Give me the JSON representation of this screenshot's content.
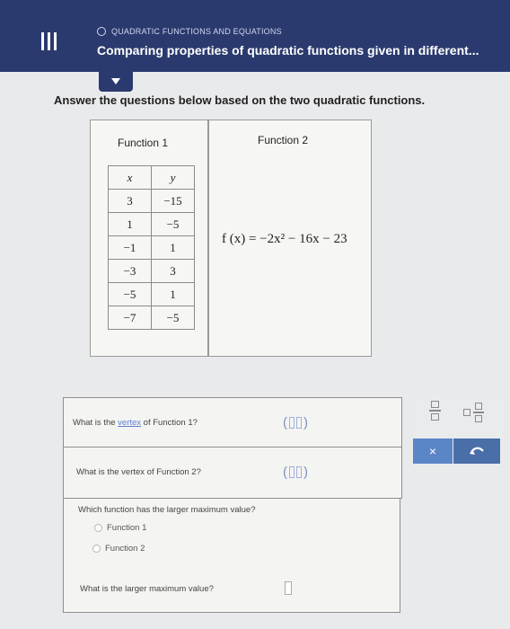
{
  "header": {
    "topic": "QUADRATIC FUNCTIONS AND EQUATIONS",
    "lesson_title": "Comparing properties of quadratic functions given in different..."
  },
  "instructions": "Answer the questions below based on the two quadratic functions.",
  "function1": {
    "title": "Function 1",
    "columns": [
      "x",
      "y"
    ],
    "rows": [
      [
        "3",
        "−15"
      ],
      [
        "1",
        "−5"
      ],
      [
        "−1",
        "1"
      ],
      [
        "−3",
        "3"
      ],
      [
        "−5",
        "1"
      ],
      [
        "−7",
        "−5"
      ]
    ]
  },
  "function2": {
    "title": "Function 2",
    "formula": "f (x) = −2x² − 16x − 23"
  },
  "questions": {
    "q1_prefix": "What is the ",
    "q1_link": "vertex",
    "q1_suffix": " of Function 1?",
    "q2": "What is the vertex of Function 2?",
    "q3": "Which function has the larger maximum value?",
    "q3_options": [
      "Function 1",
      "Function 2"
    ],
    "q4": "What is the larger maximum value?"
  },
  "tools": {
    "clear_label": "×",
    "icons": [
      "fraction-icon",
      "mixed-number-icon",
      "undo-icon"
    ]
  },
  "colors": {
    "header_bg": "#2b3a6e",
    "clear_button": "#5a86c8",
    "undo_button": "#4a6ea8"
  }
}
